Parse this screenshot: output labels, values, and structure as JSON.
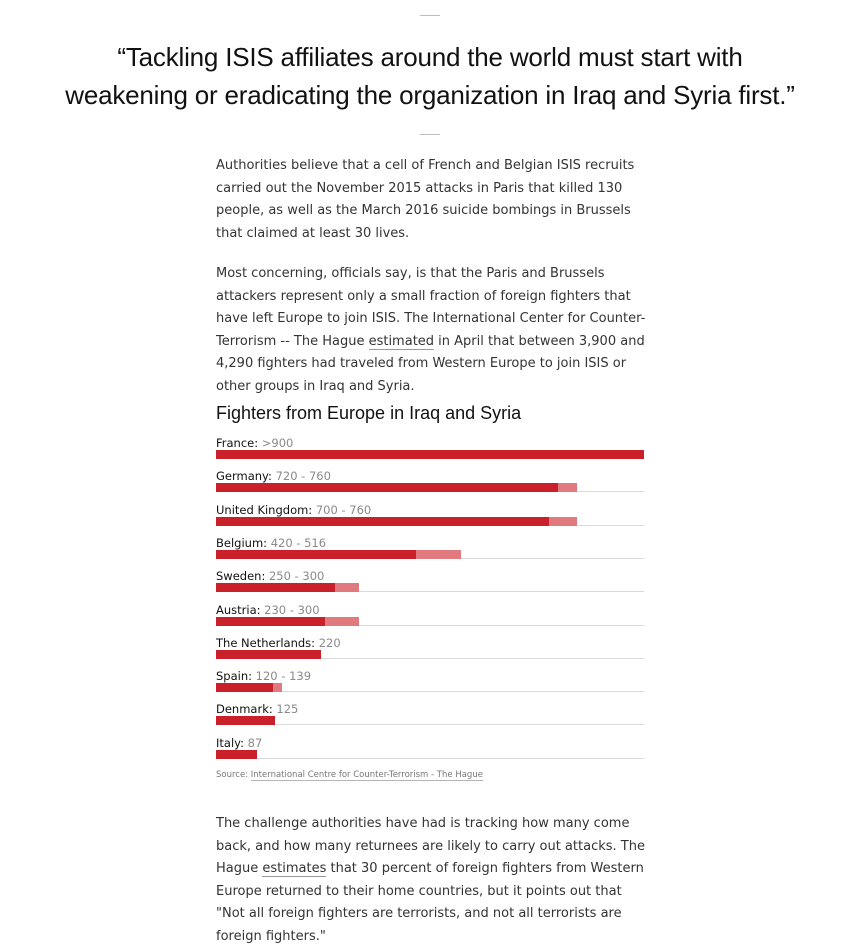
{
  "pull_quote": "“Tackling ISIS affiliates around the world must start with weakening or eradicating the organization in Iraq and Syria first.”",
  "paragraph1": "Authorities believe that a cell of French and Belgian ISIS recruits carried out the November 2015 attacks in Paris that killed 130 people, as well as the March 2016 suicide bombings in Brussels that claimed at least 30 lives.",
  "paragraph2": {
    "before_link": "Most concerning, officials say, is that the Paris and Brussels attackers represent only a small fraction of foreign fighters that have left Europe to join ISIS. The International Center for Counter-Terrorism -- The Hague ",
    "link_text": "estimated",
    "after_link": " in April that between 3,900 and 4,290 fighters had traveled from Western Europe to join ISIS or other groups in Iraq and Syria."
  },
  "paragraph3": {
    "before_link": "The challenge authorities have had is tracking how many come back, and how many returnees are likely to carry out attacks. The Hague ",
    "link_text": "estimates",
    "after_link": " that 30 percent of foreign fighters from Western Europe returned to their home countries, but it points out that \"Not all foreign fighters are terrorists, and not all terrorists are foreign fighters.\""
  },
  "colors": {
    "bar_low": "#c9202a",
    "bar_range": "#e07a7e",
    "track": "#d9d9d9"
  },
  "chart_data": {
    "type": "bar",
    "orientation": "horizontal",
    "title": "Fighters from Europe in Iraq and Syria",
    "xlim": [
      0,
      900
    ],
    "series": [
      {
        "name": "low estimate",
        "values": [
          900,
          720,
          700,
          420,
          250,
          230,
          220,
          120,
          125,
          87
        ]
      },
      {
        "name": "high estimate",
        "values": [
          900,
          760,
          760,
          516,
          300,
          300,
          220,
          139,
          125,
          87
        ]
      }
    ],
    "bars": [
      {
        "country": "France:",
        "label": ">900",
        "low": 900,
        "high": 900
      },
      {
        "country": "Germany:",
        "label": "720 - 760",
        "low": 720,
        "high": 760
      },
      {
        "country": "United Kingdom:",
        "label": "700 - 760",
        "low": 700,
        "high": 760
      },
      {
        "country": "Belgium:",
        "label": "420 - 516",
        "low": 420,
        "high": 516
      },
      {
        "country": "Sweden:",
        "label": "250 - 300",
        "low": 250,
        "high": 300
      },
      {
        "country": "Austria:",
        "label": "230 - 300",
        "low": 230,
        "high": 300
      },
      {
        "country": "The Netherlands:",
        "label": "220",
        "low": 220,
        "high": 220
      },
      {
        "country": "Spain:",
        "label": "120 - 139",
        "low": 120,
        "high": 139
      },
      {
        "country": "Denmark:",
        "label": "125",
        "low": 125,
        "high": 125
      },
      {
        "country": "Italy:",
        "label": "87",
        "low": 87,
        "high": 87
      }
    ],
    "source_prefix": "Source: ",
    "source_link": "International Centre for Counter-Terrorism - The Hague"
  }
}
